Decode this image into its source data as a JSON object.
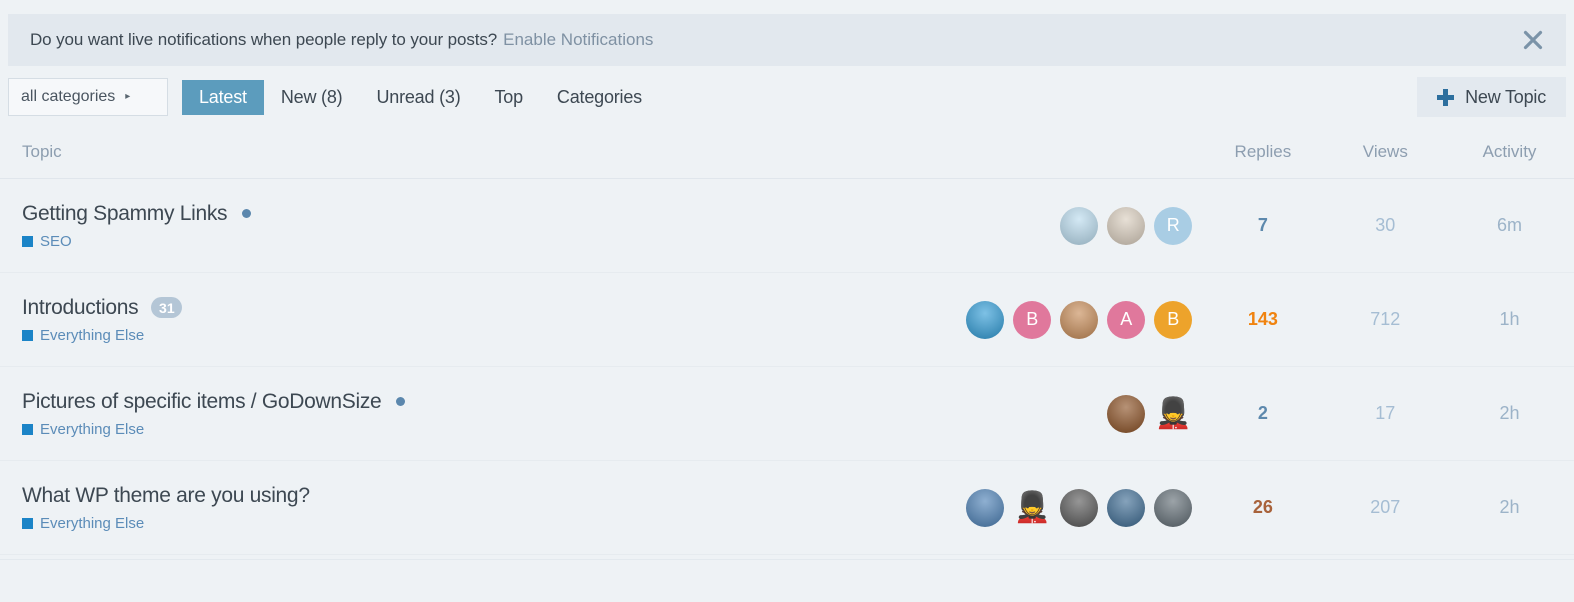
{
  "banner": {
    "message": "Do you want live notifications when people reply to your posts?",
    "link_label": "Enable Notifications",
    "close_icon": "close-icon",
    "background": "#e2e8ee"
  },
  "navbar": {
    "category_select": {
      "label": "all categories",
      "caret": "▸"
    },
    "tabs": [
      {
        "label": "Latest",
        "active": true
      },
      {
        "label": "New (8)",
        "active": false
      },
      {
        "label": "Unread (3)",
        "active": false
      },
      {
        "label": "Top",
        "active": false
      },
      {
        "label": "Categories",
        "active": false
      }
    ],
    "new_topic": {
      "label": "New Topic",
      "icon": "plus-icon"
    },
    "active_tab_color": "#5c9cbd"
  },
  "table": {
    "headers": {
      "topic": "Topic",
      "replies": "Replies",
      "views": "Views",
      "activity": "Activity"
    },
    "rows": [
      {
        "title": "Getting Spammy Links",
        "unread": true,
        "post_badge": "",
        "category": "SEO",
        "category_color": "#1b84c7",
        "posters": [
          {
            "type": "photo",
            "initial": "",
            "color": "#b9dbee"
          },
          {
            "type": "photo",
            "initial": "",
            "color": "#d9cdbd"
          },
          {
            "type": "letter",
            "initial": "R",
            "color": "#a9cde4"
          }
        ],
        "replies": "7",
        "replies_heat": "none",
        "views": "30",
        "activity": "6m"
      },
      {
        "title": "Introductions",
        "unread": false,
        "post_badge": "31",
        "category": "Everything Else",
        "category_color": "#1b84c7",
        "posters": [
          {
            "type": "photo",
            "initial": "",
            "color": "#2e9bd6"
          },
          {
            "type": "letter",
            "initial": "B",
            "color": "#e0789c"
          },
          {
            "type": "photo",
            "initial": "",
            "color": "#c68a55"
          },
          {
            "type": "letter",
            "initial": "A",
            "color": "#e0789c"
          },
          {
            "type": "letter",
            "initial": "B",
            "color": "#eda32b"
          }
        ],
        "replies": "143",
        "replies_heat": "hot",
        "views": "712",
        "activity": "1h"
      },
      {
        "title": "Pictures of specific items / GoDownSize",
        "unread": true,
        "post_badge": "",
        "category": "Everything Else",
        "category_color": "#1b84c7",
        "posters": [
          {
            "type": "photo",
            "initial": "",
            "color": "#8a4f22"
          },
          {
            "type": "emoji",
            "initial": "💂",
            "color": "transparent"
          }
        ],
        "replies": "2",
        "replies_heat": "none",
        "views": "17",
        "activity": "2h"
      },
      {
        "title": "What WP theme are you using?",
        "unread": false,
        "post_badge": "",
        "category": "Everything Else",
        "category_color": "#1b84c7",
        "posters": [
          {
            "type": "photo",
            "initial": "",
            "color": "#4a7fb5"
          },
          {
            "type": "emoji",
            "initial": "💂",
            "color": "transparent"
          },
          {
            "type": "photo",
            "initial": "",
            "color": "#565656"
          },
          {
            "type": "photo",
            "initial": "",
            "color": "#3b6a92"
          },
          {
            "type": "photo",
            "initial": "",
            "color": "#5f6b73"
          }
        ],
        "replies": "26",
        "replies_heat": "warm",
        "views": "207",
        "activity": "2h"
      }
    ]
  }
}
